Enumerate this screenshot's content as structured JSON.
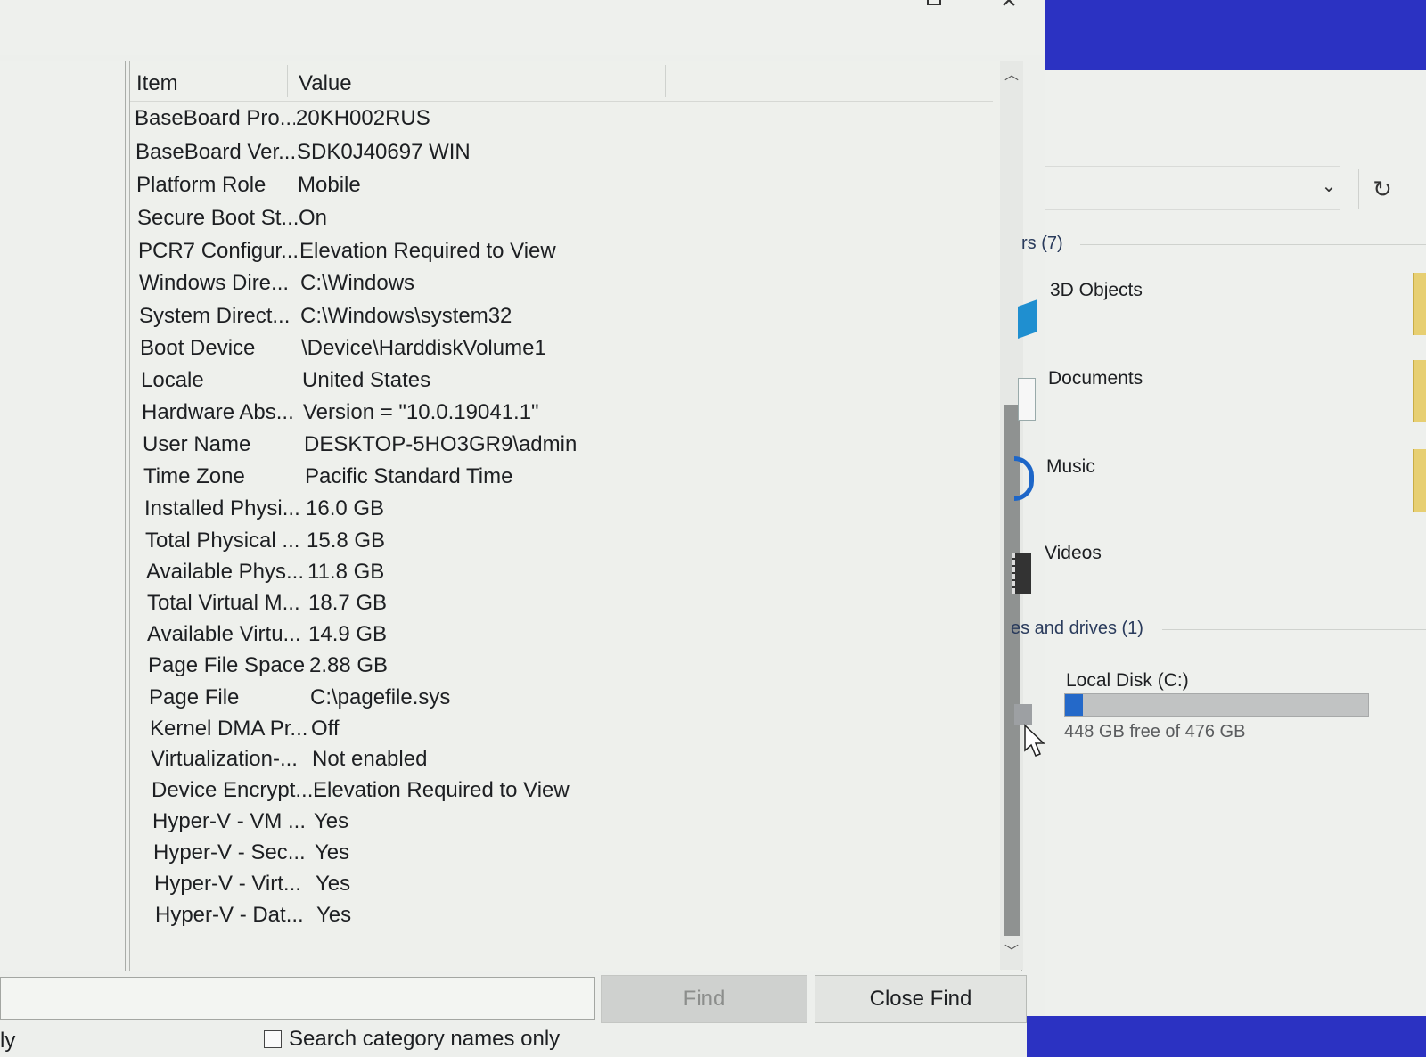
{
  "sysinfo": {
    "list": {
      "columns": [
        "Item",
        "Value"
      ],
      "rows": [
        {
          "item": "BaseBoard Pro...",
          "value": "20KH002RUS"
        },
        {
          "item": "BaseBoard Ver...",
          "value": "SDK0J40697 WIN"
        },
        {
          "item": "Platform Role",
          "value": "Mobile"
        },
        {
          "item": "Secure Boot St...",
          "value": "On"
        },
        {
          "item": "PCR7 Configur...",
          "value": "Elevation Required to View"
        },
        {
          "item": "Windows Dire...",
          "value": "C:\\Windows"
        },
        {
          "item": "System Direct...",
          "value": "C:\\Windows\\system32"
        },
        {
          "item": "Boot Device",
          "value": "\\Device\\HarddiskVolume1"
        },
        {
          "item": "Locale",
          "value": "United States"
        },
        {
          "item": "Hardware Abs...",
          "value": "Version = \"10.0.19041.1\""
        },
        {
          "item": "User Name",
          "value": "DESKTOP-5HO3GR9\\admin"
        },
        {
          "item": "Time Zone",
          "value": "Pacific Standard Time"
        },
        {
          "item": "Installed Physi...",
          "value": "16.0 GB"
        },
        {
          "item": "Total Physical ...",
          "value": "15.8 GB"
        },
        {
          "item": "Available Phys...",
          "value": "11.8 GB"
        },
        {
          "item": "Total Virtual M...",
          "value": "18.7 GB"
        },
        {
          "item": "Available Virtu...",
          "value": "14.9 GB"
        },
        {
          "item": "Page File Space",
          "value": "2.88 GB"
        },
        {
          "item": "Page File",
          "value": "C:\\pagefile.sys"
        },
        {
          "item": "Kernel DMA Pr...",
          "value": "Off"
        },
        {
          "item": "Virtualization-...",
          "value": "Not enabled"
        },
        {
          "item": "Device Encrypt...",
          "value": "Elevation Required to View"
        },
        {
          "item": "Hyper-V - VM ...",
          "value": "Yes"
        },
        {
          "item": "Hyper-V - Sec...",
          "value": "Yes"
        },
        {
          "item": "Hyper-V - Virt...",
          "value": "Yes"
        },
        {
          "item": "Hyper-V - Dat...",
          "value": "Yes"
        }
      ]
    },
    "find": {
      "find_label": "Find",
      "close_find_label": "Close Find",
      "partial_label": "ly",
      "checkbox_label": "Search category names only",
      "checkbox_checked": false
    }
  },
  "explorer": {
    "folders_header": "rs (7)",
    "folders": [
      "3D Objects",
      "Documents",
      "Music",
      "Videos"
    ],
    "drives_header": "es and drives (1)",
    "drive": {
      "label": "Local Disk (C:)",
      "free_text": "448 GB free of 476 GB",
      "used_fraction": 0.06
    },
    "colors": {
      "taskbar_blue": "#2b32c2",
      "drive_fill": "#2469c9"
    }
  }
}
